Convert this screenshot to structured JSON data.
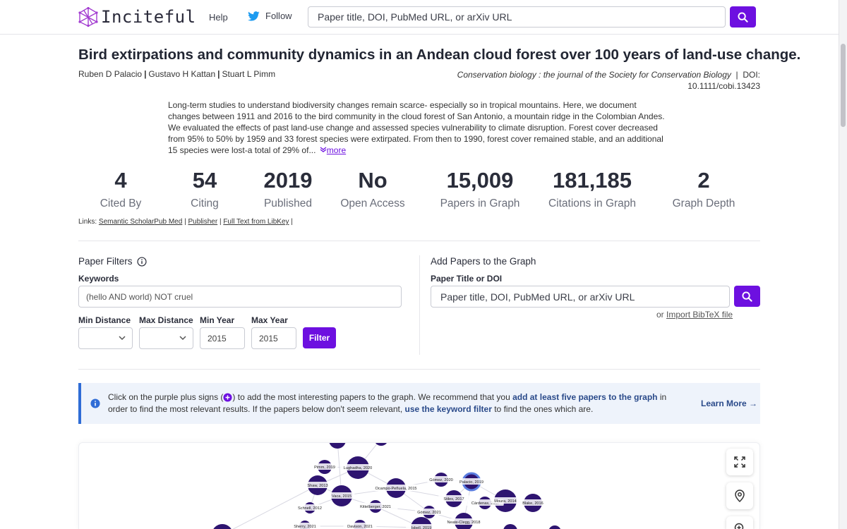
{
  "header": {
    "logo_text": "Inciteful",
    "nav_help": "Help",
    "nav_follow": "Follow",
    "search_placeholder": "Paper title, DOI, PubMed URL, or arXiv URL"
  },
  "paper": {
    "title": "Bird extirpations and community dynamics in an Andean cloud forest over 100 years of land-use change.",
    "authors": [
      "Ruben D Palacio",
      "Gustavo H Kattan",
      "Stuart L Pimm"
    ],
    "journal": "Conservation biology : the journal of the Society for Conservation Biology",
    "doi_label": "DOI:",
    "doi": "10.1111/cobi.13423",
    "abstract": "Long-term studies to understand biodiversity changes remain scarce- especially so in tropical mountains. Here, we document changes between 1911 and 2016 to the bird community in the cloud forest of San Antonio, a mountain ridge in the Colombian Andes. We evaluated the effects of past land-use change and assessed species vulnerability to climate disruption. Forest cover decreased from 95% to 50% by 1959 and 33 forest species were extirpated. From then to 1990, forest cover remained stable, and an additional 15 species were lost-a total of 29% of...",
    "more_label": "more"
  },
  "stats": [
    {
      "value": "4",
      "label": "Cited By"
    },
    {
      "value": "54",
      "label": "Citing"
    },
    {
      "value": "2019",
      "label": "Published"
    },
    {
      "value": "No",
      "label": "Open Access"
    },
    {
      "value": "15,009",
      "label": "Papers in Graph"
    },
    {
      "value": "181,185",
      "label": "Citations in Graph"
    },
    {
      "value": "2",
      "label": "Graph Depth"
    }
  ],
  "links": {
    "prefix": "Links:",
    "items": [
      "Semantic Scholar",
      "Pub Med",
      "Publisher",
      "Full Text from LibKey"
    ]
  },
  "filters": {
    "title": "Paper Filters",
    "keywords_label": "Keywords",
    "keywords_placeholder": "(hello AND world) NOT cruel",
    "min_distance_label": "Min Distance",
    "max_distance_label": "Max Distance",
    "min_year_label": "Min Year",
    "max_year_label": "Max Year",
    "min_year_placeholder": "2015",
    "max_year_placeholder": "2015",
    "filter_button": "Filter"
  },
  "add_papers": {
    "title": "Add Papers to the Graph",
    "field_label": "Paper Title or DOI",
    "placeholder": "Paper title, DOI, PubMed URL, or arXiv URL",
    "or_text": "or",
    "import_label": "Import BibTeX file"
  },
  "banner": {
    "text_1": "Click on the purple plus signs (",
    "text_2": ") to add the most interesting papers to the graph. We recommend that you ",
    "bold_1": "add at least five papers to the graph",
    "text_3": " in order to find the most relevant results. If the papers below don't seem relevant, ",
    "bold_2": "use the keyword filter",
    "text_4": " to find the ones which are.",
    "learn_more": "Learn More →"
  },
  "graph": {
    "nodes": [
      {
        "label": "Pimm, 2019"
      },
      {
        "label": "Lughadha, 2020"
      },
      {
        "label": "Shaw, 2013"
      },
      {
        "label": "Vaca, 2015"
      },
      {
        "label": "Ocampo-Peñuela, 2015"
      },
      {
        "label": "Gómez, 2020"
      },
      {
        "label": "Palacio, 2019"
      },
      {
        "label": "Stiles, 2017"
      },
      {
        "label": "Cárdenas, 20..."
      },
      {
        "label": "Moura, 2014"
      },
      {
        "label": "Blake, 2016"
      },
      {
        "label": "Schnell, 2012"
      },
      {
        "label": "Kittelberger, 2021"
      },
      {
        "label": "Gómez, 2021"
      },
      {
        "label": "Neate-Clegg, 2018"
      },
      {
        "label": "Sherry, 2021"
      },
      {
        "label": "Davison, 2021"
      },
      {
        "label": "Isbell, 2019"
      }
    ]
  }
}
